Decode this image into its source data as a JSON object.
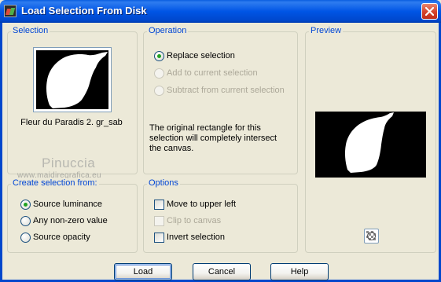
{
  "window": {
    "title": "Load Selection From Disk",
    "icon": "paint-shop-pro-icon",
    "close_icon": "close-icon"
  },
  "selection": {
    "group_label": "Selection",
    "file_name": "Fleur du Paradis 2. gr_sab"
  },
  "watermark": {
    "name": "Pinuccia",
    "url": "www.maidiregrafica.eu"
  },
  "operation": {
    "group_label": "Operation",
    "options": [
      {
        "label": "Replace selection",
        "checked": true,
        "enabled": true
      },
      {
        "label": "Add to current selection",
        "checked": false,
        "enabled": false
      },
      {
        "label": "Subtract from current selection",
        "checked": false,
        "enabled": false
      }
    ],
    "info": "The original rectangle for this selection will completely intersect the canvas."
  },
  "preview": {
    "group_label": "Preview",
    "bg_toggle_icon": "checkerboard-icon"
  },
  "create_from": {
    "group_label": "Create selection from:",
    "options": [
      {
        "label": "Source luminance",
        "checked": true
      },
      {
        "label": "Any non-zero value",
        "checked": false
      },
      {
        "label": "Source opacity",
        "checked": false
      }
    ]
  },
  "options": {
    "group_label": "Options",
    "items": [
      {
        "label": "Move to upper left",
        "checked": false,
        "enabled": true
      },
      {
        "label": "Clip to canvas",
        "checked": false,
        "enabled": false
      },
      {
        "label": "Invert selection",
        "checked": false,
        "enabled": true
      }
    ]
  },
  "buttons": {
    "load": "Load",
    "cancel": "Cancel",
    "help": "Help"
  },
  "colors": {
    "title_bar": "#0055e5",
    "dialog_bg": "#ece9d8",
    "group_label": "#0046d5",
    "radio_dot": "#21a121"
  }
}
